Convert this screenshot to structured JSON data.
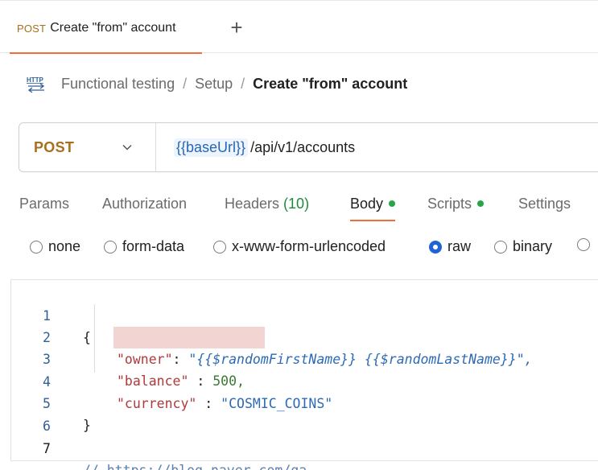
{
  "tab": {
    "method": "POST",
    "title": "Create \"from\" account",
    "new_tab_icon": "plus-icon"
  },
  "breadcrumb": {
    "icon": "http-icon",
    "items": [
      "Functional testing",
      "Setup"
    ],
    "separator": "/",
    "current": "Create \"from\" account"
  },
  "request": {
    "method": "POST",
    "url_variable": "{{baseUrl}}",
    "url_path": "/api/v1/accounts"
  },
  "request_tabs": [
    {
      "label": "Params"
    },
    {
      "label": "Authorization"
    },
    {
      "label": "Headers",
      "count": "(10)"
    },
    {
      "label": "Body",
      "active": true
    },
    {
      "label": "Scripts"
    },
    {
      "label": "Settings"
    }
  ],
  "body_types": {
    "options": [
      "none",
      "form-data",
      "x-www-form-urlencoded",
      "raw",
      "binary"
    ],
    "selected": "raw"
  },
  "editor": {
    "lines": [
      {
        "number": "1",
        "text": "{"
      },
      {
        "number": "2",
        "key": "\"owner\"",
        "sep": ": ",
        "value": "\"{{$randomFirstName}} {{$randomLastName}}\","
      },
      {
        "number": "3",
        "key": "\"balance\"",
        "sep": " : ",
        "value": "500,"
      },
      {
        "number": "4",
        "key": "\"currency\"",
        "sep": " : ",
        "value": "\"COSMIC_COINS\""
      },
      {
        "number": "5",
        "text": "}"
      },
      {
        "number": "6",
        "text": ""
      },
      {
        "number": "7",
        "comment": "// https://blog.naver.com/qa-_-"
      }
    ]
  },
  "colors": {
    "accent": "#f26b3a",
    "method": "#a86f1d",
    "radio_selected": "#1f63d4",
    "status_dot": "#27a648",
    "highlight": "#f2d5d2"
  }
}
